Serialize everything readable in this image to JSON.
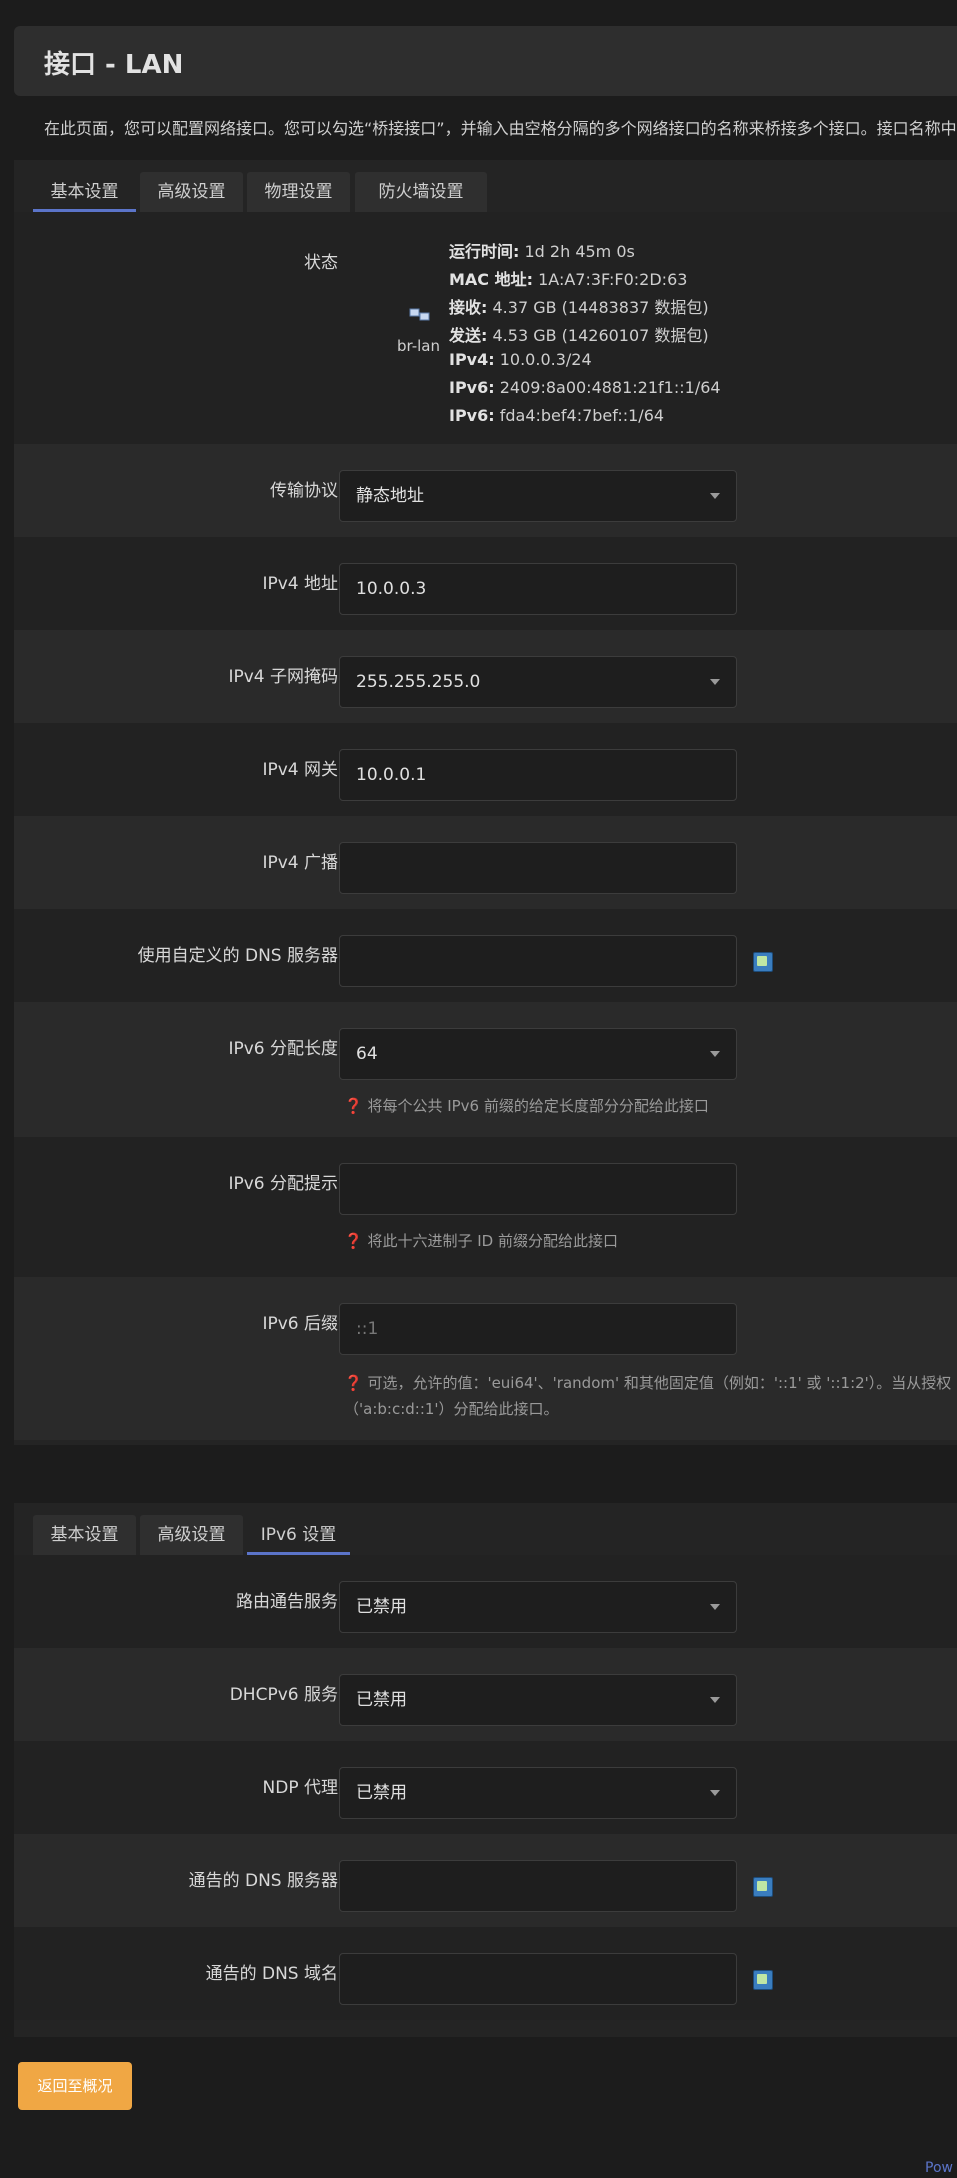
{
  "page": {
    "title": "接口 - LAN",
    "description": "在此页面，您可以配置网络接口。您可以勾选“桥接接口”，并输入由空格分隔的多个网络接口的名称来桥接多个接口。接口名称中"
  },
  "tabs_main": [
    "基本设置",
    "高级设置",
    "物理设置",
    "防火墙设置"
  ],
  "status": {
    "label": "状态",
    "device": "br-lan",
    "lines": [
      {
        "k": "运行时间:",
        "v": " 1d 2h 45m 0s"
      },
      {
        "k": "MAC 地址:",
        "v": " 1A:A7:3F:F0:2D:63"
      },
      {
        "k": "接收:",
        "v": " 4.37 GB (14483837 数据包)"
      },
      {
        "k": "发送:",
        "v": " 4.53 GB (14260107 数据包)"
      },
      {
        "k": "IPv4:",
        "v": " 10.0.0.3/24"
      },
      {
        "k": "IPv6:",
        "v": " 2409:8a00:4881:21f1::1/64"
      },
      {
        "k": "IPv6:",
        "v": " fda4:bef4:7bef::1/64"
      }
    ]
  },
  "fields": {
    "protocol": {
      "label": "传输协议",
      "value": "静态地址"
    },
    "ipv4_addr": {
      "label": "IPv4 地址",
      "value": "10.0.0.3"
    },
    "ipv4_mask": {
      "label": "IPv4 子网掩码",
      "value": "255.255.255.0"
    },
    "ipv4_gw": {
      "label": "IPv4 网关",
      "value": "10.0.0.1"
    },
    "ipv4_bcast": {
      "label": "IPv4 广播",
      "value": ""
    },
    "dns": {
      "label": "使用自定义的 DNS 服务器",
      "value": ""
    },
    "ip6_assign": {
      "label": "IPv6 分配长度",
      "value": "64",
      "hint": "❓ 将每个公共 IPv6 前缀的给定长度部分分配给此接口"
    },
    "ip6_hint": {
      "label": "IPv6 分配提示",
      "value": "",
      "hint": "❓ 将此十六进制子 ID 前缀分配给此接口"
    },
    "ip6_suffix": {
      "label": "IPv6 后缀",
      "placeholder": "::1",
      "hint1": "❓ 可选，允许的值：'eui64'、'random' 和其他固定值（例如：'::1' 或 '::1:2'）。当从授权",
      "hint2": "（'a:b:c:d::1'）分配给此接口。"
    }
  },
  "tabs_dhcp": [
    "基本设置",
    "高级设置",
    "IPv6 设置"
  ],
  "dhcp": {
    "ra": {
      "label": "路由通告服务",
      "value": "已禁用"
    },
    "dhcpv6": {
      "label": "DHCPv6 服务",
      "value": "已禁用"
    },
    "ndp": {
      "label": "NDP 代理",
      "value": "已禁用"
    },
    "adv_dns": {
      "label": "通告的 DNS 服务器",
      "value": ""
    },
    "adv_domain": {
      "label": "通告的 DNS 域名",
      "value": ""
    }
  },
  "buttons": {
    "back": "返回至概况"
  },
  "footer": {
    "link": "Pow"
  },
  "colors": {
    "accent": "#5b74c9",
    "back_button": "#f0a744"
  }
}
